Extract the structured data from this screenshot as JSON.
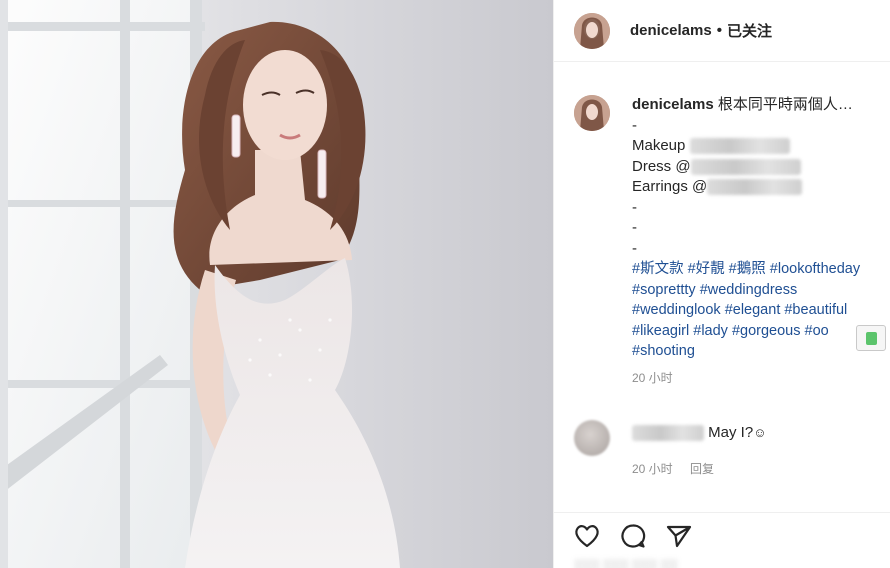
{
  "post": {
    "username": "denicelams",
    "separator": "•",
    "follow_status": "已关注"
  },
  "caption": {
    "username": "denicelams",
    "text": "根本同平時兩個人…",
    "lines": [
      "-",
      "Makeup",
      "Dress @",
      "Earrings @",
      "-",
      "-",
      "-"
    ],
    "hashtags": [
      "#斯文款 #好靚 #鵝照 #lookoftheday",
      "#soprettty #weddingdress",
      "#weddinglook #elegant #beautiful",
      "#likeagirl #lady #gorgeous #oo",
      "#shooting"
    ],
    "time": "20 小时"
  },
  "comment": {
    "text": "May I?",
    "time": "20 小时",
    "reply": "回复"
  },
  "actions": {
    "like_icon": "heart-icon",
    "comment_icon": "comment-bubble-icon",
    "share_icon": "paper-plane-icon"
  },
  "colors": {
    "hashtag": "#1f4f93",
    "meta": "#8e8e8e",
    "text": "#262626"
  }
}
